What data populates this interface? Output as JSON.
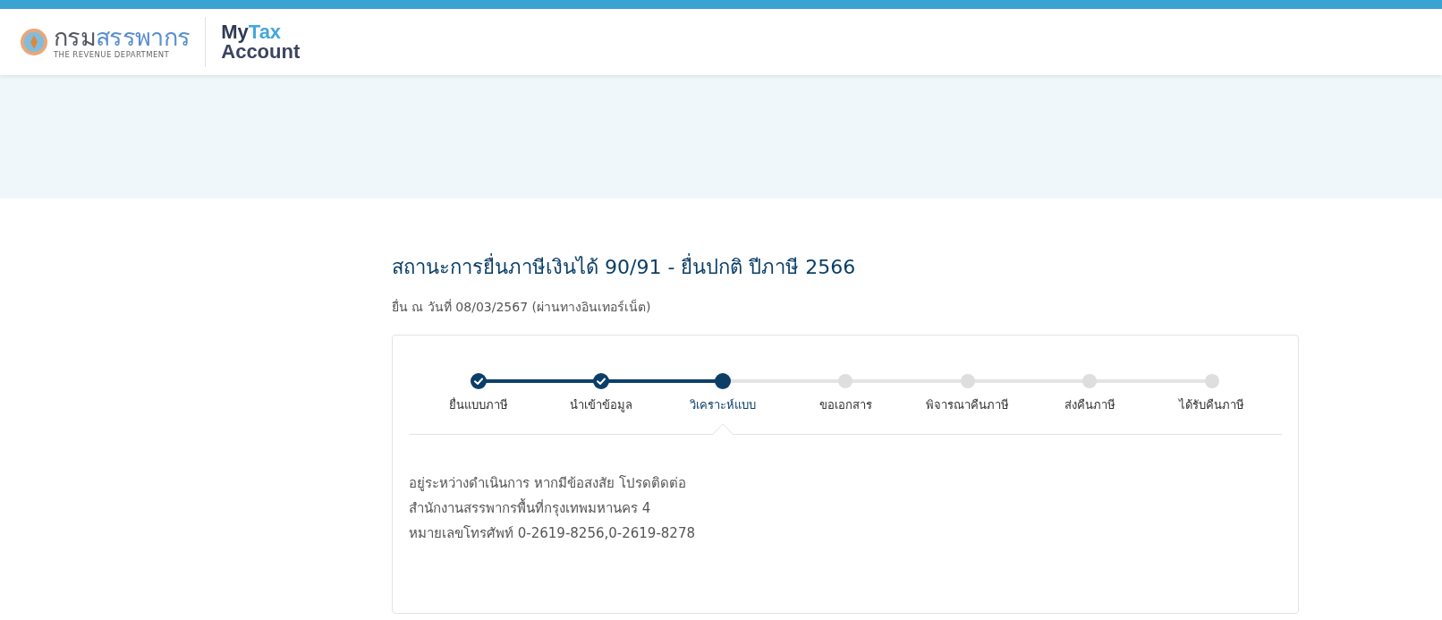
{
  "header": {
    "org_name_first": "กรม",
    "org_name_second": "สรรพากร",
    "org_subtitle": "THE REVENUE DEPARTMENT",
    "app_name_first": "My",
    "app_name_second": "Tax",
    "app_name_third": "Account"
  },
  "status": {
    "title": "สถานะการยื่นภาษีเงินได้ 90/91 - ยื่นปกติ ปีภาษี 2566",
    "filed_note": "ยื่น ณ วันที่ 08/03/2567 (ผ่านทางอินเทอร์เน็ต)",
    "steps": [
      {
        "label": "ยื่นแบบภาษี",
        "kind": "done",
        "selected": false
      },
      {
        "label": "นำเข้าข้อมูล",
        "kind": "done",
        "selected": false
      },
      {
        "label": "วิเคราะห์แบบ",
        "kind": "current",
        "selected": true
      },
      {
        "label": "ขอเอกสาร",
        "kind": "pending",
        "selected": false
      },
      {
        "label": "พิจารณาคืนภาษี",
        "kind": "pending",
        "selected": false
      },
      {
        "label": "ส่งคืนภาษี",
        "kind": "pending",
        "selected": false
      },
      {
        "label": "ได้รับคืนภาษี",
        "kind": "pending",
        "selected": false
      }
    ],
    "message_lines": [
      "อยู่ระหว่างดำเนินการ หากมีข้อสงสัย โปรดติดต่อ",
      "สำนักงานสรรพากรพื้นที่กรุงเทพมหานคร 4",
      "หมายเลขโทรศัพท์ 0-2619-8256,0-2619-8278"
    ]
  }
}
